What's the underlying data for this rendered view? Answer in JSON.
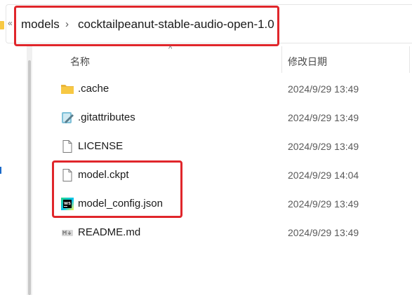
{
  "breadcrumb": {
    "leading_chevron": "«",
    "items": [
      "models",
      "cocktailpeanut-stable-audio-open-1.0"
    ],
    "separator": "›"
  },
  "columns": {
    "name": "名称",
    "date_modified": "修改日期",
    "sort_indicator": "^"
  },
  "files": [
    {
      "name": ".cache",
      "date": "2024/9/29 13:49",
      "icon": "folder-icon"
    },
    {
      "name": ".gitattributes",
      "date": "2024/9/29 13:49",
      "icon": "notepad-file-icon"
    },
    {
      "name": "LICENSE",
      "date": "2024/9/29 13:49",
      "icon": "blank-file-icon"
    },
    {
      "name": "model.ckpt",
      "date": "2024/9/29 14:04",
      "icon": "blank-file-icon"
    },
    {
      "name": "model_config.json",
      "date": "2024/9/29 13:49",
      "icon": "webstorm-file-icon"
    },
    {
      "name": "README.md",
      "date": "2024/9/29 13:49",
      "icon": "markdown-file-icon"
    }
  ],
  "colors": {
    "highlight": "#e0262b",
    "folder": "#f7c843",
    "webstorm_gradient": [
      "#21d789",
      "#07c3f2",
      "#fcf84a"
    ]
  }
}
